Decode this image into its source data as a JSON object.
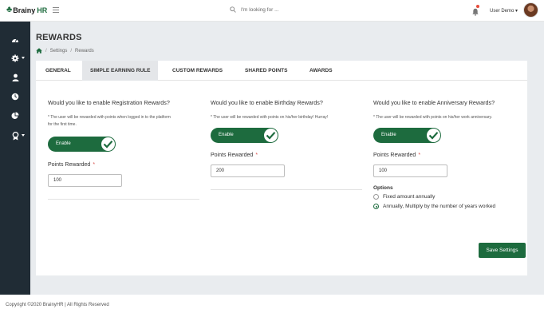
{
  "brand": {
    "name_part1": "Brainy",
    "name_part2": "HR"
  },
  "search": {
    "placeholder": "I'm looking for ..."
  },
  "user": {
    "name": "User Demo"
  },
  "page": {
    "title": "REWARDS"
  },
  "breadcrumb": {
    "items": [
      "Settings",
      "Rewards"
    ]
  },
  "tabs": [
    {
      "label": "GENERAL"
    },
    {
      "label": "SIMPLE EARNING RULE"
    },
    {
      "label": "CUSTOM REWARDS"
    },
    {
      "label": "SHARED POINTS"
    },
    {
      "label": "AWARDS"
    }
  ],
  "active_tab": "SIMPLE EARNING RULE",
  "sections": {
    "registration": {
      "question": "Would you like to enable Registration Rewards?",
      "note_line1": "* The user will be rewarded with points when logged in to the platform",
      "note_line2": "for the first time.",
      "toggle_label": "Enable",
      "points_label": "Points Rewarded",
      "required_mark": "*",
      "points_value": "100"
    },
    "birthday": {
      "question": "Would you like to enable Birthday Rewards?",
      "note_line1": "* The user will be rewarded with points on his/her birthday! Hurray!",
      "toggle_label": "Enable",
      "points_label": "Points Rewarded",
      "required_mark": "*",
      "points_value": "200"
    },
    "anniversary": {
      "question": "Would you like to enable Anniversary Rewards?",
      "note_line1": "* The user will be rewarded with points on his/her work anniversary.",
      "toggle_label": "Enable",
      "points_label": "Points Rewarded",
      "required_mark": "*",
      "points_value": "100",
      "options_title": "Options",
      "options": [
        {
          "label": "Fixed amount annually",
          "selected": false
        },
        {
          "label": "Annually, Multiply by the number of years worked",
          "selected": true
        }
      ]
    }
  },
  "actions": {
    "save_label": "Save Settings"
  },
  "footer": {
    "text": "Copyright ©2020 BrainyHR | All Rights Reserved"
  },
  "colors": {
    "brand_green": "#1d6b3e",
    "sidebar_bg": "#202c35",
    "content_bg": "#e9ecef",
    "required_red": "#d9534f"
  },
  "sidebar_icons": [
    "dashboard-icon",
    "settings-icon",
    "user-icon",
    "clock-icon",
    "pie-chart-icon",
    "award-icon"
  ]
}
